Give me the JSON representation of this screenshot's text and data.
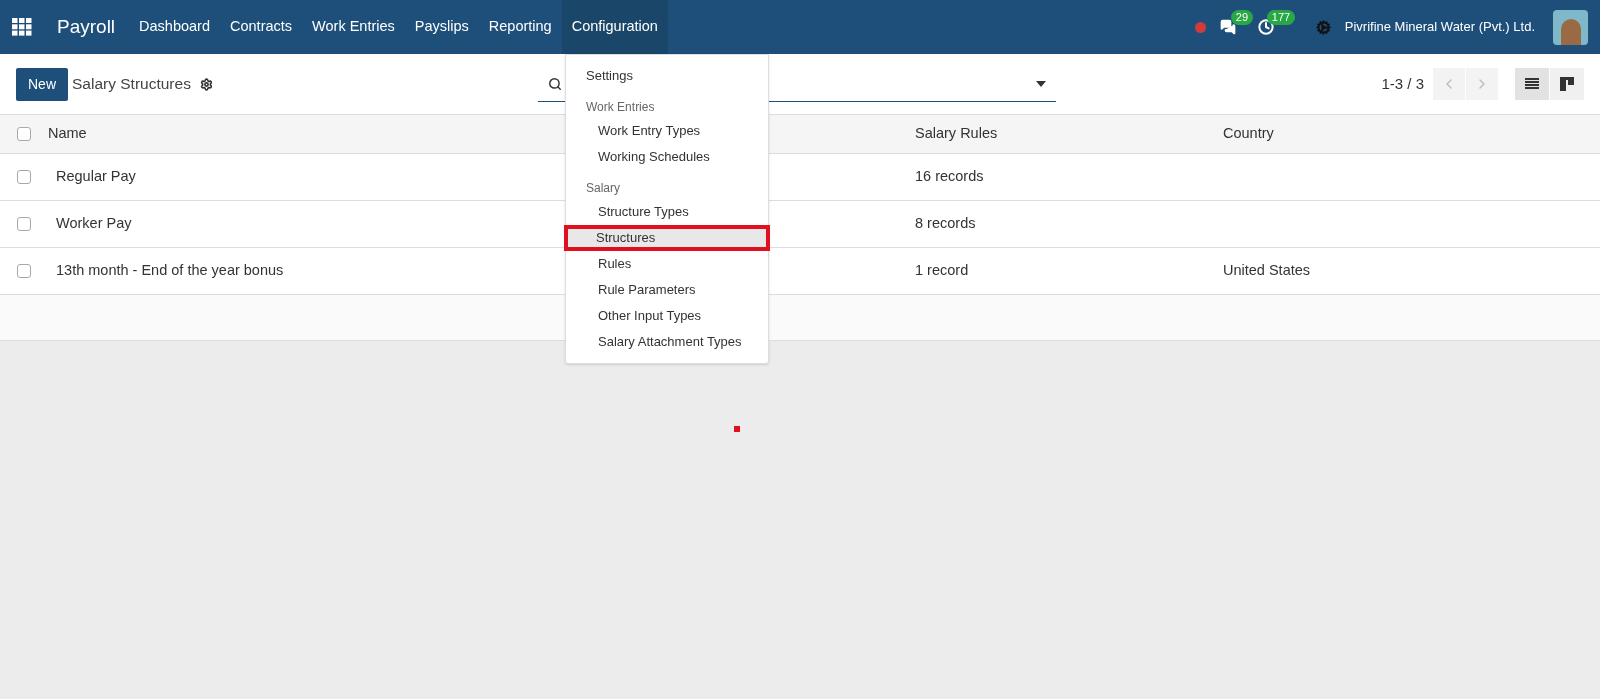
{
  "navbar": {
    "app_name": "Payroll",
    "menu": [
      {
        "label": "Dashboard",
        "selected": false
      },
      {
        "label": "Contracts",
        "selected": false
      },
      {
        "label": "Work Entries",
        "selected": false
      },
      {
        "label": "Payslips",
        "selected": false
      },
      {
        "label": "Reporting",
        "selected": false
      },
      {
        "label": "Configuration",
        "selected": true
      }
    ],
    "messages_count": "29",
    "activities_count": "177",
    "company": "Pivrifine Mineral Water (Pvt.) Ltd."
  },
  "control_panel": {
    "new_button": "New",
    "title": "Salary Structures",
    "pager": "1-3 / 3",
    "views": [
      {
        "kind": "list",
        "selected": true
      },
      {
        "kind": "kanban",
        "selected": false
      }
    ]
  },
  "table": {
    "all_checked": false,
    "columns": [
      "Name",
      "Salary Rules",
      "Country"
    ],
    "rows": [
      {
        "name": "Regular Pay",
        "salary_rules": "16 records",
        "country": "",
        "checked": false
      },
      {
        "name": "Worker Pay",
        "salary_rules": "8 records",
        "country": "",
        "checked": false
      },
      {
        "name": "13th month - End of the year bonus",
        "salary_rules": "1 record",
        "country": "United States",
        "checked": false
      }
    ]
  },
  "dropdown": [
    {
      "kind": "item",
      "label": "Settings",
      "selected": false
    },
    {
      "kind": "header",
      "label": "Work Entries"
    },
    {
      "kind": "subitem",
      "label": "Work Entry Types",
      "selected": false
    },
    {
      "kind": "subitem",
      "label": "Working Schedules",
      "selected": false
    },
    {
      "kind": "header",
      "label": "Salary"
    },
    {
      "kind": "subitem",
      "label": "Structure Types",
      "selected": false
    },
    {
      "kind": "subitem",
      "label": "Structures",
      "selected": true
    },
    {
      "kind": "subitem",
      "label": "Rules",
      "selected": false
    },
    {
      "kind": "subitem",
      "label": "Rule Parameters",
      "selected": false
    },
    {
      "kind": "subitem",
      "label": "Other Input Types",
      "selected": false
    },
    {
      "kind": "subitem",
      "label": "Salary Attachment Types",
      "selected": false
    }
  ]
}
